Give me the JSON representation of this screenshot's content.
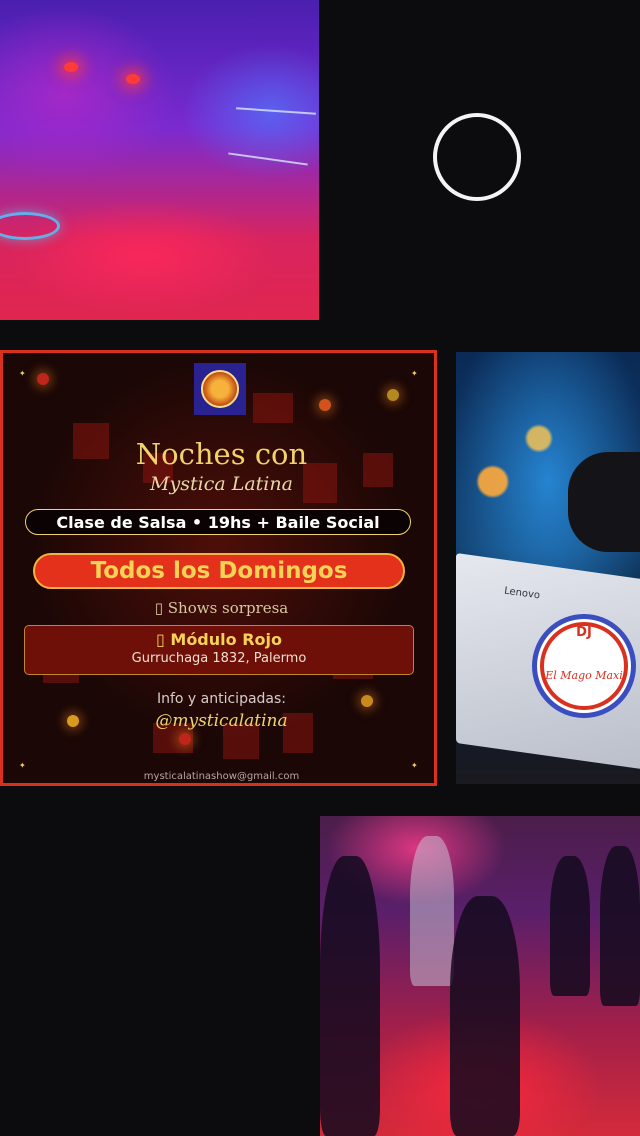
{
  "media": {
    "club_photo_alt": "",
    "dj_photo": {
      "laptop_brand": "Lenovo",
      "sticker_dj": "DJ",
      "sticker_name": "El Mago Maxi"
    }
  },
  "flyer": {
    "title_line_1": "Noches con",
    "title_line_2": "Mystica Latina",
    "class_bar": "Clase de Salsa  •  19hs  +  Baile Social",
    "days": "Todos los Domingos",
    "shows": "▯ Shows sorpresa",
    "venue_name": "▯  Módulo Rojo",
    "venue_address": "Gurruchaga 1832, Palermo",
    "info_label": "Info y anticipadas:",
    "handle": "@mysticalatina",
    "email": "mysticalatinashow@gmail.com"
  },
  "colors": {
    "accent_red": "#d9301f",
    "gold": "#f2d36a",
    "background": "#0c0b0d"
  },
  "icons": {
    "record": "record-circle-icon"
  }
}
